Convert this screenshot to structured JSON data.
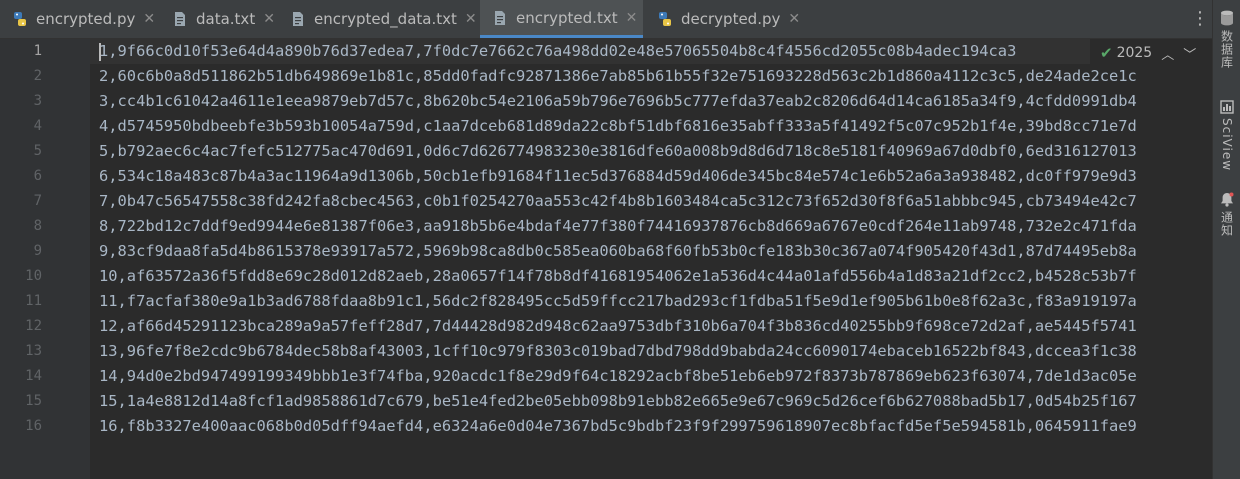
{
  "tabs": [
    {
      "label": "encrypted.py",
      "icon": "python-file-icon",
      "active": false
    },
    {
      "label": "data.txt",
      "icon": "text-file-icon",
      "active": false
    },
    {
      "label": "encrypted_data.txt",
      "icon": "text-file-icon",
      "active": false
    },
    {
      "label": "encrypted.txt",
      "icon": "text-file-icon",
      "active": true
    },
    {
      "label": "decrypted.py",
      "icon": "python-file-icon",
      "active": false
    }
  ],
  "tab_close_glyph": "✕",
  "more_glyph": "⋮",
  "stripe": [
    {
      "label": "数据库",
      "icon": "database-icon"
    },
    {
      "label": "SciView",
      "icon": "sciview-icon"
    },
    {
      "label": "通知",
      "icon": "bell-icon"
    }
  ],
  "inspection": {
    "count": "2025",
    "up": "︿",
    "down": "﹀"
  },
  "colors": {
    "background": "#2b2b2b",
    "gutter": "#313335",
    "accent": "#4a88c7",
    "text": "#a9b7c6",
    "tabbar": "#3c3f41"
  },
  "lines": [
    {
      "n": "1",
      "text": "1,9f66c0d10f53e64d4a890b76d37edea7,7f0dc7e7662c76a498dd02e48e57065504b8c4f4556cd2055c08b4adec194ca3"
    },
    {
      "n": "2",
      "text": "2,60c6b0a8d511862b51db649869e1b81c,85dd0fadfc92871386e7ab85b61b55f32e751693228d563c2b1d860a4112c3c5,de24ade2ce1c"
    },
    {
      "n": "3",
      "text": "3,cc4b1c61042a4611e1eea9879eb7d57c,8b620bc54e2106a59b796e7696b5c777efda37eab2c8206d64d14ca6185a34f9,4cfdd0991db4"
    },
    {
      "n": "4",
      "text": "4,d5745950bdbeebfe3b593b10054a759d,c1aa7dceb681d89da22c8bf51dbf6816e35abff333a5f41492f5c07c952b1f4e,39bd8cc71e7d"
    },
    {
      "n": "5",
      "text": "5,b792aec6c4ac7fefc512775ac470d691,0d6c7d626774983230e3816dfe60a008b9d8d6d718c8e5181f40969a67d0dbf0,6ed316127013"
    },
    {
      "n": "6",
      "text": "6,534c18a483c87b4a3ac11964a9d1306b,50cb1efb91684f11ec5d376884d59d406de345bc84e574c1e6b52a6a3a938482,dc0ff979e9d3"
    },
    {
      "n": "7",
      "text": "7,0b47c56547558c38fd242fa8cbec4563,c0b1f0254270aa553c42f4b8b1603484ca5c312c73f652d30f8f6a51abbbc945,cb73494e42c7"
    },
    {
      "n": "8",
      "text": "8,722bd12c7ddf9ed9944e6e81387f06e3,aa918b5b6e4bdaf4e77f380f74416937876cb8d669a6767e0cdf264e11ab9748,732e2c471fda"
    },
    {
      "n": "9",
      "text": "9,83cf9daa8fa5d4b8615378e93917a572,5969b98ca8db0c585ea060ba68f60fb53b0cfe183b30c367a074f905420f43d1,87d74495eb8a"
    },
    {
      "n": "10",
      "text": "10,af63572a36f5fdd8e69c28d012d82aeb,28a0657f14f78b8df41681954062e1a536d4c44a01afd556b4a1d83a21df2cc2,b4528c53b7f"
    },
    {
      "n": "11",
      "text": "11,f7acfaf380e9a1b3ad6788fdaa8b91c1,56dc2f828495cc5d59ffcc217bad293cf1fdba51f5e9d1ef905b61b0e8f62a3c,f83a919197a"
    },
    {
      "n": "12",
      "text": "12,af66d45291123bca289a9a57feff28d7,7d44428d982d948c62aa9753dbf310b6a704f3b836cd40255bb9f698ce72d2af,ae5445f5741"
    },
    {
      "n": "13",
      "text": "13,96fe7f8e2cdc9b6784dec58b8af43003,1cff10c979f8303c019bad7dbd798dd9babda24cc6090174ebaceb16522bf843,dccea3f1c38"
    },
    {
      "n": "14",
      "text": "14,94d0e2bd947499199349bbb1e3f74fba,920acdc1f8e29d9f64c18292acbf8be51eb6eb972f8373b787869eb623f63074,7de1d3ac05e"
    },
    {
      "n": "15",
      "text": "15,1a4e8812d14a8fcf1ad9858861d7c679,be51e4fed2be05ebb098b91ebb82e665e9e67c969c5d26cef6b627088bad5b17,0d54b25f167"
    },
    {
      "n": "16",
      "text": "16,f8b3327e400aac068b0d05dff94aefd4,e6324a6e0d04e7367bd5c9bdbf23f9f299759618907ec8bfacfd5ef5e594581b,0645911fae9"
    }
  ]
}
